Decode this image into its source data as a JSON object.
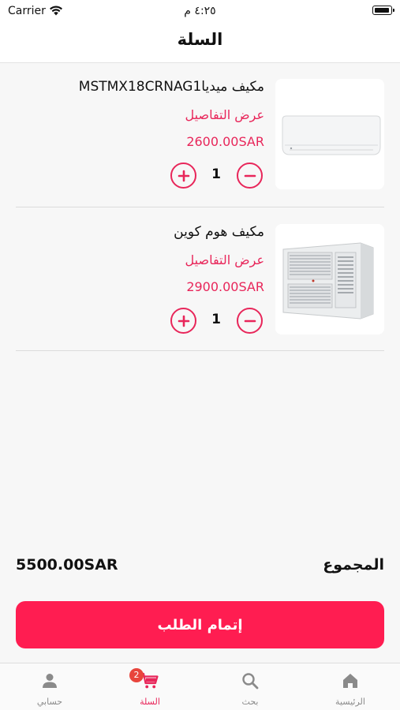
{
  "status_bar": {
    "carrier": "Carrier",
    "time": "٤:٢٥ م"
  },
  "header": {
    "title": "السلة"
  },
  "cart": {
    "items": [
      {
        "name": "مكيف ميدياMSTMX18CRNAG1",
        "details_link": "عرض التفاصيل",
        "price": "2600.00SAR",
        "quantity": "1",
        "image": "split-ac-image"
      },
      {
        "name": "مكيف هوم كوين",
        "details_link": "عرض التفاصيل",
        "price": "2900.00SAR",
        "quantity": "1",
        "image": "window-ac-image"
      }
    ],
    "total_label": "المجموع",
    "total_value": "5500.00SAR",
    "checkout_label": "إتمام الطلب"
  },
  "tabs": [
    {
      "label": "الرئيسية",
      "icon": "home-icon"
    },
    {
      "label": "بحث",
      "icon": "search-icon"
    },
    {
      "label": "السلة",
      "icon": "cart-icon",
      "badge": "2",
      "active": true
    },
    {
      "label": "حسابي",
      "icon": "person-icon"
    }
  ],
  "colors": {
    "accent": "#e8265a",
    "button": "#ff1d51",
    "badge": "#e8453c"
  }
}
